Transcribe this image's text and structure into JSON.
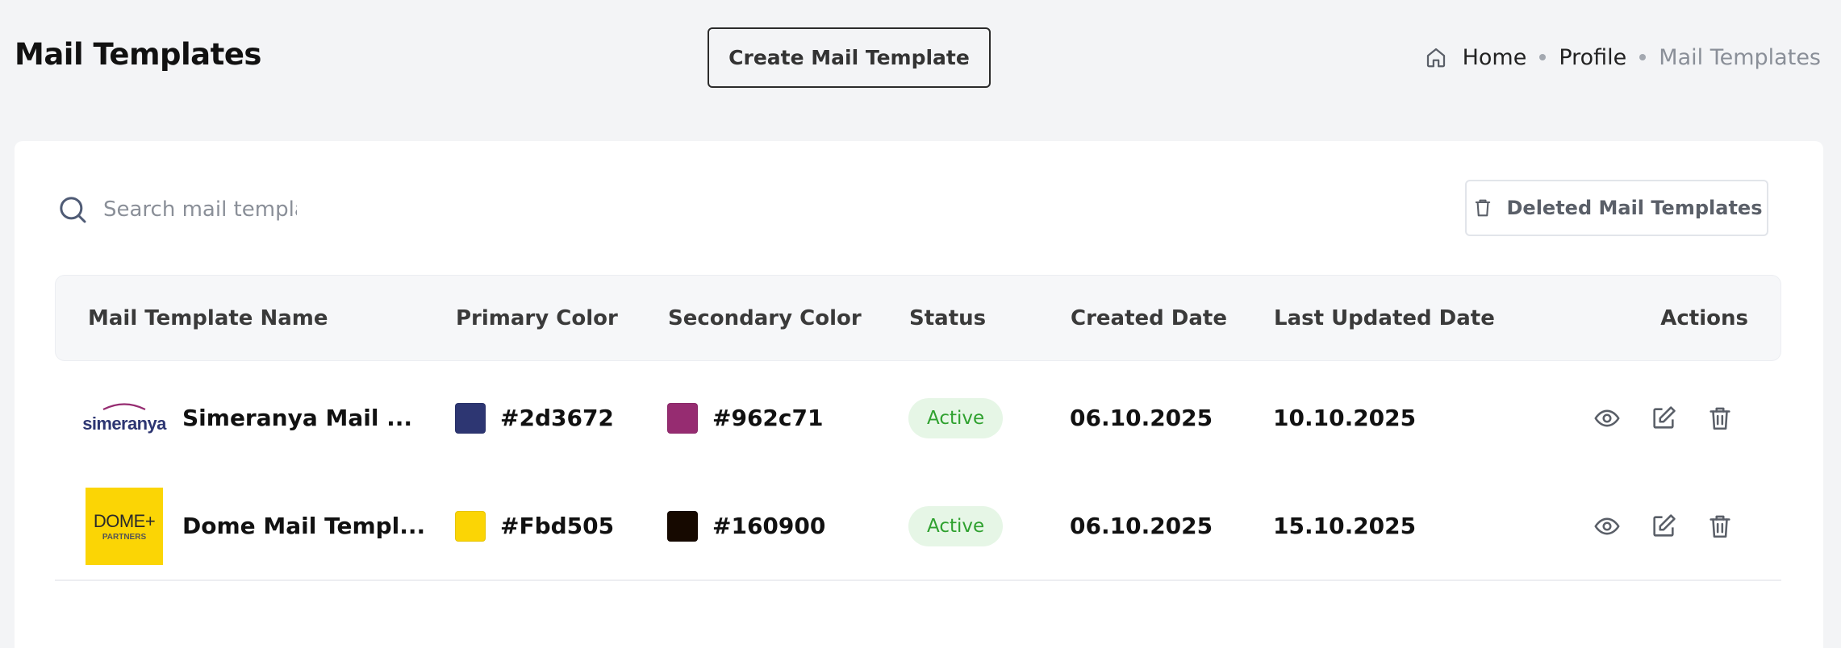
{
  "header": {
    "title": "Mail Templates",
    "create_button": "Create Mail Template"
  },
  "breadcrumb": {
    "items": [
      "Home",
      "Profile",
      "Mail Templates"
    ]
  },
  "toolbar": {
    "search_placeholder": "Search mail template",
    "deleted_button": "Deleted Mail Templates"
  },
  "table": {
    "columns": [
      "Mail Template Name",
      "Primary Color",
      "Secondary Color",
      "Status",
      "Created Date",
      "Last Updated Date",
      "Actions"
    ],
    "rows": [
      {
        "logo_text": "simeranya",
        "name": "Simeranya Mail ...",
        "primary_color": "#2d3672",
        "secondary_color": "#962c71",
        "status": "Active",
        "created": "06.10.2025",
        "updated": "10.10.2025"
      },
      {
        "logo_text": "DOME+",
        "logo_sub": "PARTNERS",
        "name": "Dome Mail Templ...",
        "primary_color": "#Fbd505",
        "secondary_color": "#160900",
        "status": "Active",
        "created": "06.10.2025",
        "updated": "15.10.2025"
      }
    ]
  },
  "icons": {
    "home": "home-icon",
    "search": "search-icon",
    "trash": "trash-icon",
    "view": "eye-icon",
    "edit": "edit-icon",
    "delete": "trash-icon"
  },
  "colors": {
    "background": "#f3f4f6",
    "card": "#ffffff",
    "status_active_bg": "#e6f6e6",
    "status_active_text": "#2fa12f"
  }
}
